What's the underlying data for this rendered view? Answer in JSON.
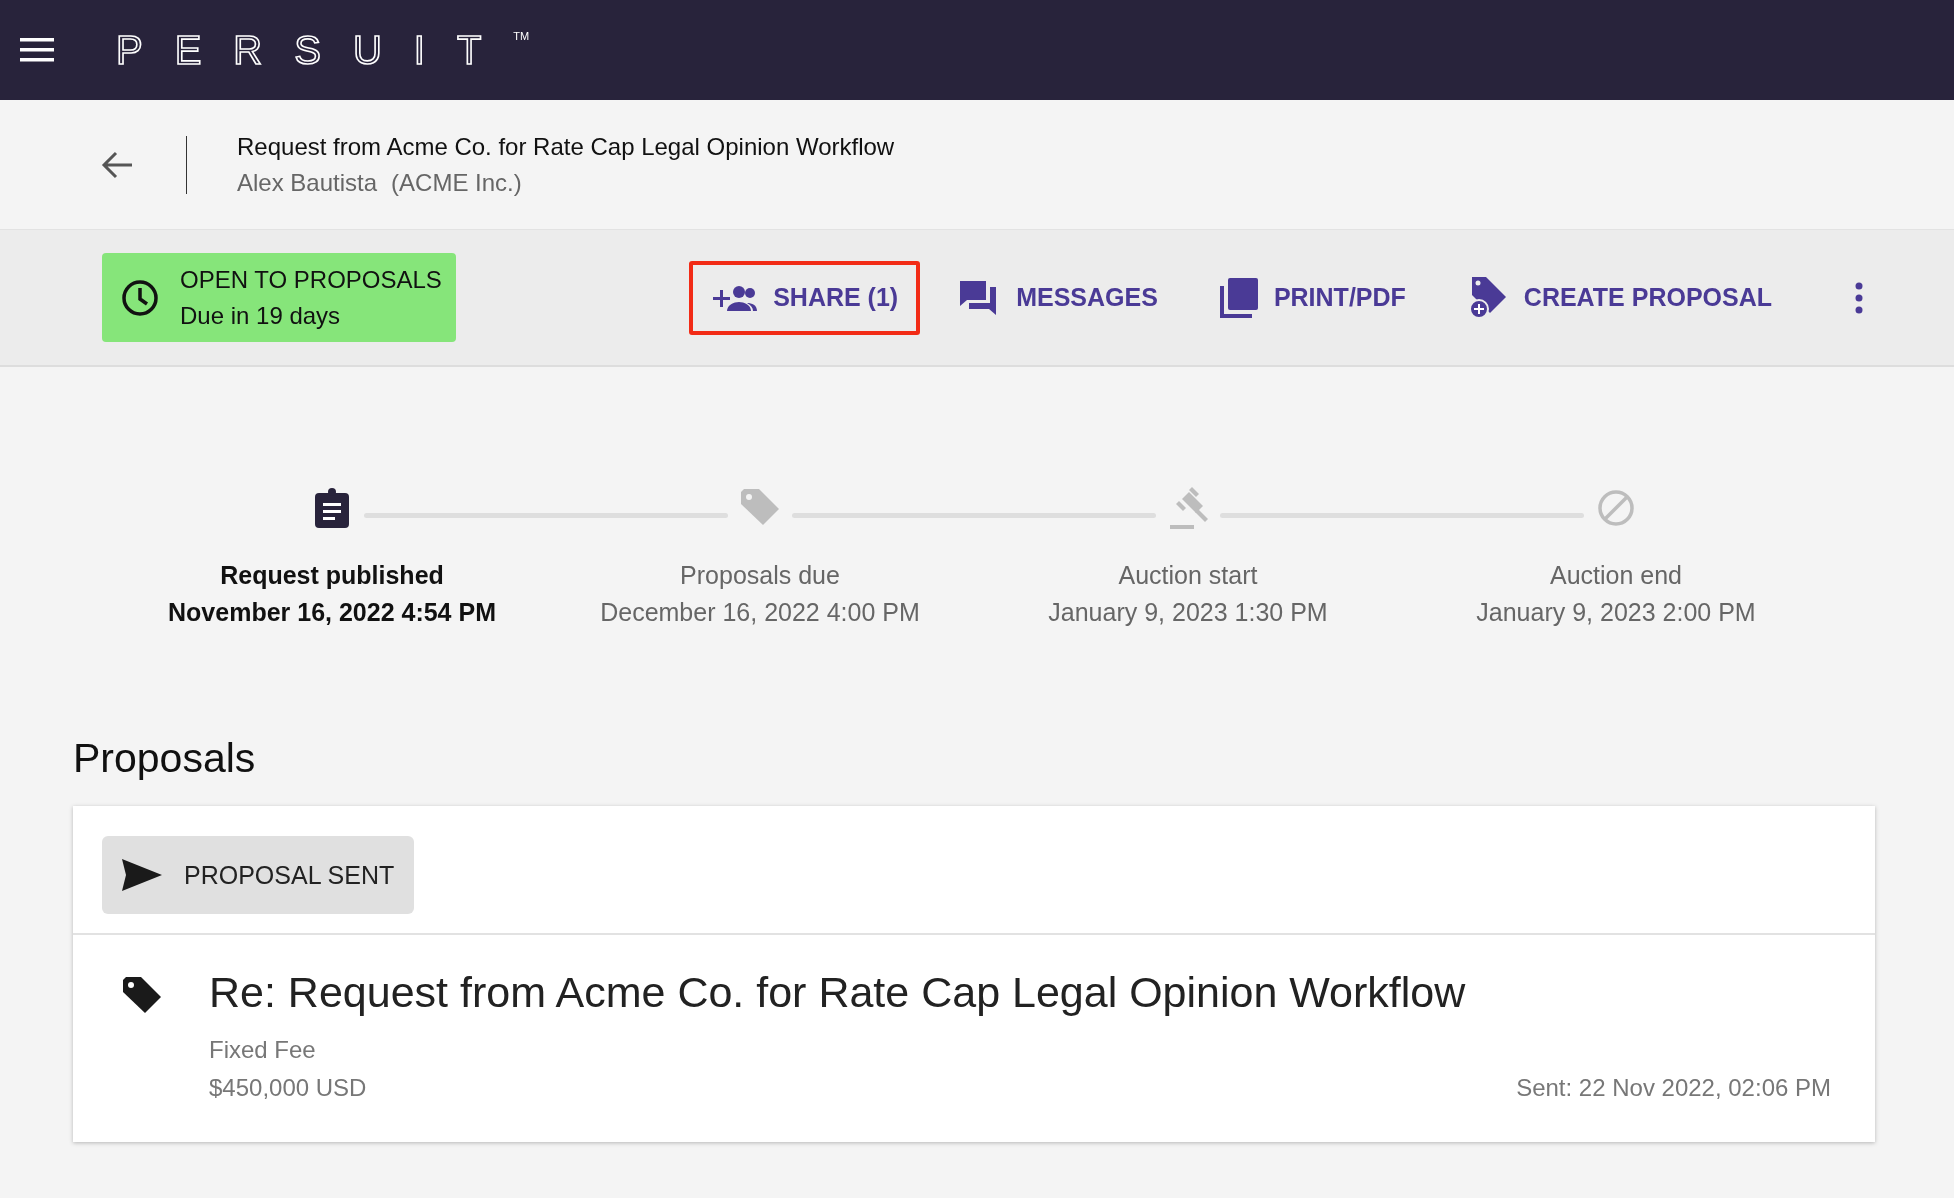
{
  "app_bar": {
    "logo": "PERSUIT",
    "trademark": "TM"
  },
  "request": {
    "title": "Request from Acme Co. for Rate Cap Legal Opinion Workflow",
    "requester": "Alex Bautista",
    "company": "(ACME Inc.)"
  },
  "status": {
    "label": "OPEN TO PROPOSALS",
    "due": "Due in 19 days"
  },
  "actions": [
    {
      "kind": "share",
      "label": "SHARE (1)",
      "highlighted": true
    },
    {
      "kind": "messages",
      "label": "MESSAGES",
      "highlighted": false
    },
    {
      "kind": "pdf",
      "label": "PRINT/PDF",
      "highlighted": false
    },
    {
      "kind": "create",
      "label": "CREATE PROPOSAL",
      "highlighted": false
    }
  ],
  "timeline": [
    {
      "kind": "clipboard",
      "label": "Request published",
      "date": "November 16, 2022 4:54 PM",
      "completed": true
    },
    {
      "kind": "tag",
      "label": "Proposals due",
      "date": "December 16, 2022 4:00 PM",
      "completed": false
    },
    {
      "kind": "gavel",
      "label": "Auction start",
      "date": "January 9, 2023 1:30 PM",
      "completed": false
    },
    {
      "kind": "block",
      "label": "Auction end",
      "date": "January 9, 2023 2:00 PM",
      "completed": false
    }
  ],
  "proposals": {
    "heading": "Proposals",
    "items": [
      {
        "status": "PROPOSAL SENT",
        "title": "Re: Request from Acme Co. for Rate Cap Legal Opinion Workflow",
        "fee_type": "Fixed Fee",
        "amount": "$450,000 USD",
        "sent": "Sent: 22 Nov 2022, 02:06 PM"
      }
    ]
  }
}
